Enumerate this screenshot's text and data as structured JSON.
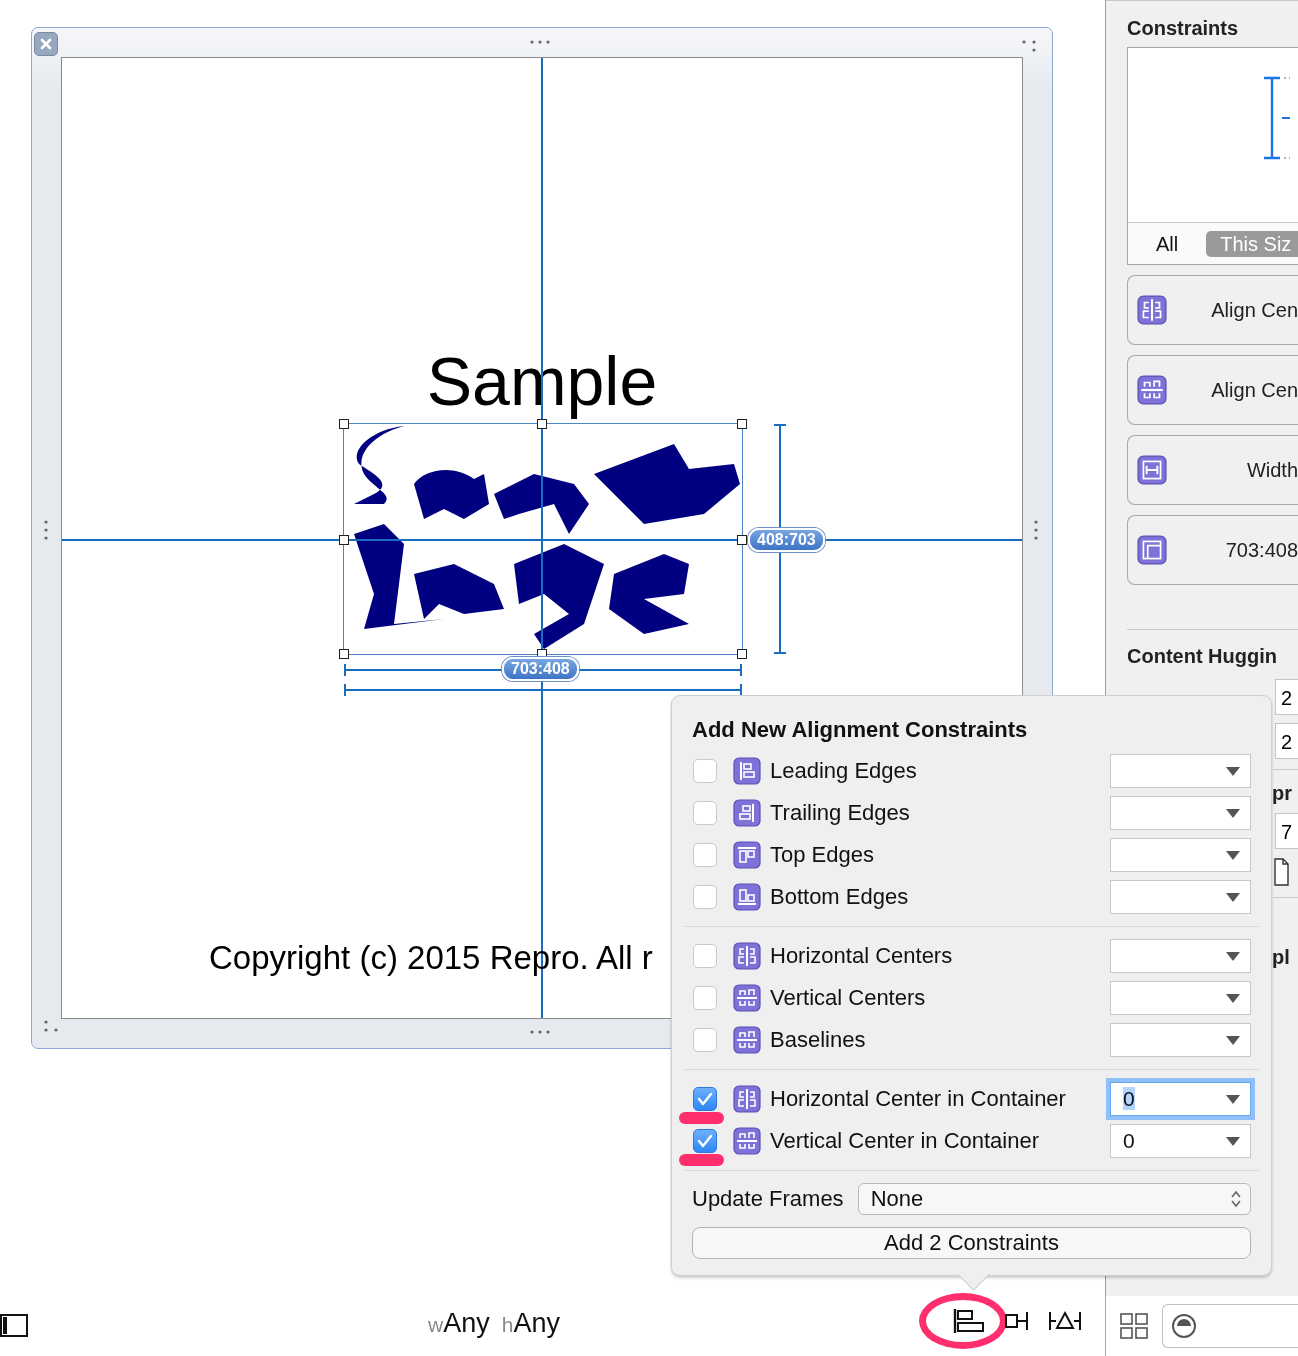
{
  "canvas": {
    "label": "Sample",
    "badges": [
      "408:703",
      "703:408"
    ],
    "copyright": "Copyright (c) 2015 Repro. All r"
  },
  "inspector": {
    "title": "Constraints",
    "size_tabs": [
      {
        "label": "All",
        "selected": false
      },
      {
        "label": "This Siz",
        "selected": true
      }
    ],
    "constraints": [
      {
        "kind": "hcenter",
        "label": "Align Cen"
      },
      {
        "kind": "vcenter",
        "label": "Align Cen"
      },
      {
        "kind": "width",
        "label": "Width"
      },
      {
        "kind": "ratio",
        "label": "703:408"
      }
    ],
    "hugging_title": "Content Huggin",
    "hugging_values": [
      "2",
      "2"
    ],
    "compression_title": "pr",
    "compression_values": [
      "7"
    ],
    "placeholder_title": "pl"
  },
  "popover": {
    "title": "Add New Alignment Constraints",
    "groups": [
      {
        "rows": [
          {
            "kind": "leading",
            "label": "Leading Edges",
            "checked": false,
            "focused": false,
            "highlighted": false
          },
          {
            "kind": "trailing",
            "label": "Trailing Edges",
            "checked": false,
            "focused": false,
            "highlighted": false
          },
          {
            "kind": "top",
            "label": "Top Edges",
            "checked": false,
            "focused": false,
            "highlighted": false
          },
          {
            "kind": "bottom",
            "label": "Bottom Edges",
            "checked": false,
            "focused": false,
            "highlighted": false
          }
        ]
      },
      {
        "rows": [
          {
            "kind": "hcenter",
            "label": "Horizontal Centers",
            "checked": false,
            "focused": false,
            "highlighted": false
          },
          {
            "kind": "vcenter",
            "label": "Vertical Centers",
            "checked": false,
            "focused": false,
            "highlighted": false
          },
          {
            "kind": "vcenter",
            "label": "Baselines",
            "checked": false,
            "focused": false,
            "highlighted": false
          }
        ]
      },
      {
        "rows": [
          {
            "kind": "hcenter",
            "label": "Horizontal Center in Container",
            "checked": true,
            "value": "0",
            "focused": true,
            "highlighted": true
          },
          {
            "kind": "vcenter",
            "label": "Vertical Center in Container",
            "checked": true,
            "value": "0",
            "focused": false,
            "highlighted": true
          }
        ]
      }
    ],
    "update_frames": {
      "label": "Update Frames",
      "value": "None"
    },
    "add_button": "Add 2 Constraints"
  },
  "bottom_bar": {
    "size_class": {
      "width_prefix": "w",
      "width_value": "Any",
      "height_prefix": "h",
      "height_value": "Any"
    },
    "tools": [
      {
        "kind": "align",
        "highlighted": true
      },
      {
        "kind": "pin",
        "highlighted": false
      },
      {
        "kind": "resolve",
        "highlighted": false
      }
    ]
  }
}
